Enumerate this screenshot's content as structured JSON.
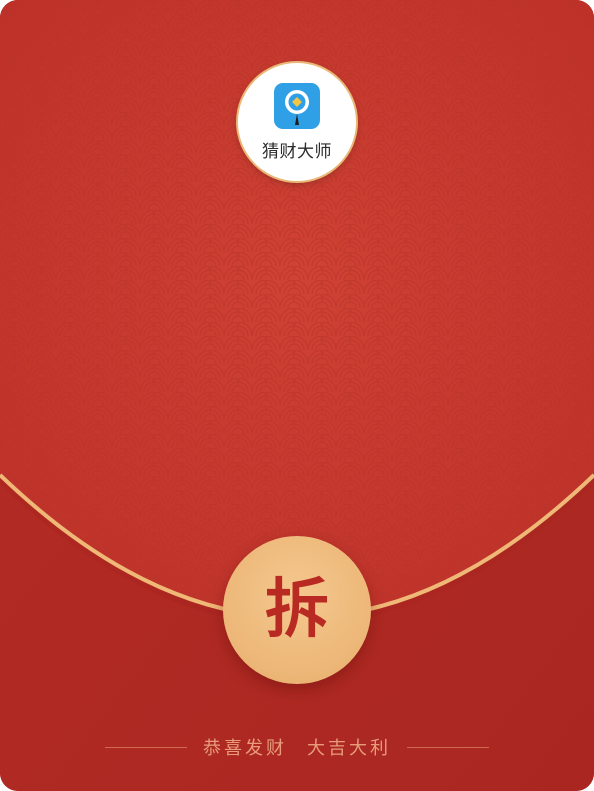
{
  "brand": {
    "name": "猜财大师",
    "icon": "magnifier-coin-icon"
  },
  "envelope": {
    "open_label": "拆"
  },
  "footer": {
    "blessing_left": "恭喜发财",
    "blessing_right": "大吉大利"
  },
  "colors": {
    "envelope_red": "#b8302a",
    "flap_red": "#c73a2e",
    "gold": "#ecb677",
    "button_text": "#b82a22",
    "footer_text": "#e89c7c",
    "logo_blue": "#2f9fe6"
  }
}
